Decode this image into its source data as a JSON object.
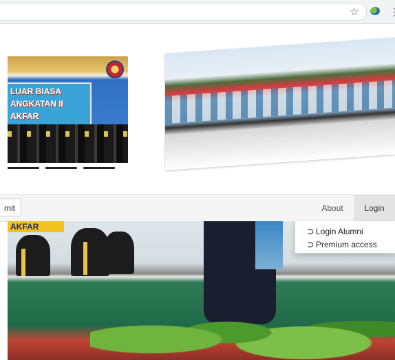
{
  "browser": {
    "bookmark_icon": "star-icon",
    "extension_icon": "extension-icon",
    "menu_icon": "kebab-menu-icon"
  },
  "carousel": {
    "slide_left": {
      "banner_lines": [
        "LUAR BIASA",
        "ANGKATAN II",
        "AKFAR"
      ]
    }
  },
  "navbar": {
    "submit_label": "mit",
    "about_label": "About",
    "login_label": "Login"
  },
  "login_menu": {
    "items": [
      {
        "label": "Login Alumni",
        "icon": "login-icon"
      },
      {
        "label": "Premium access",
        "icon": "login-icon"
      }
    ]
  },
  "photo": {
    "tag_text": "AKFAR"
  },
  "colors": {
    "navbar_bg": "#f5f5f5",
    "active_nav_bg": "#e4e4e4",
    "accent_gold": "#f0c320"
  }
}
